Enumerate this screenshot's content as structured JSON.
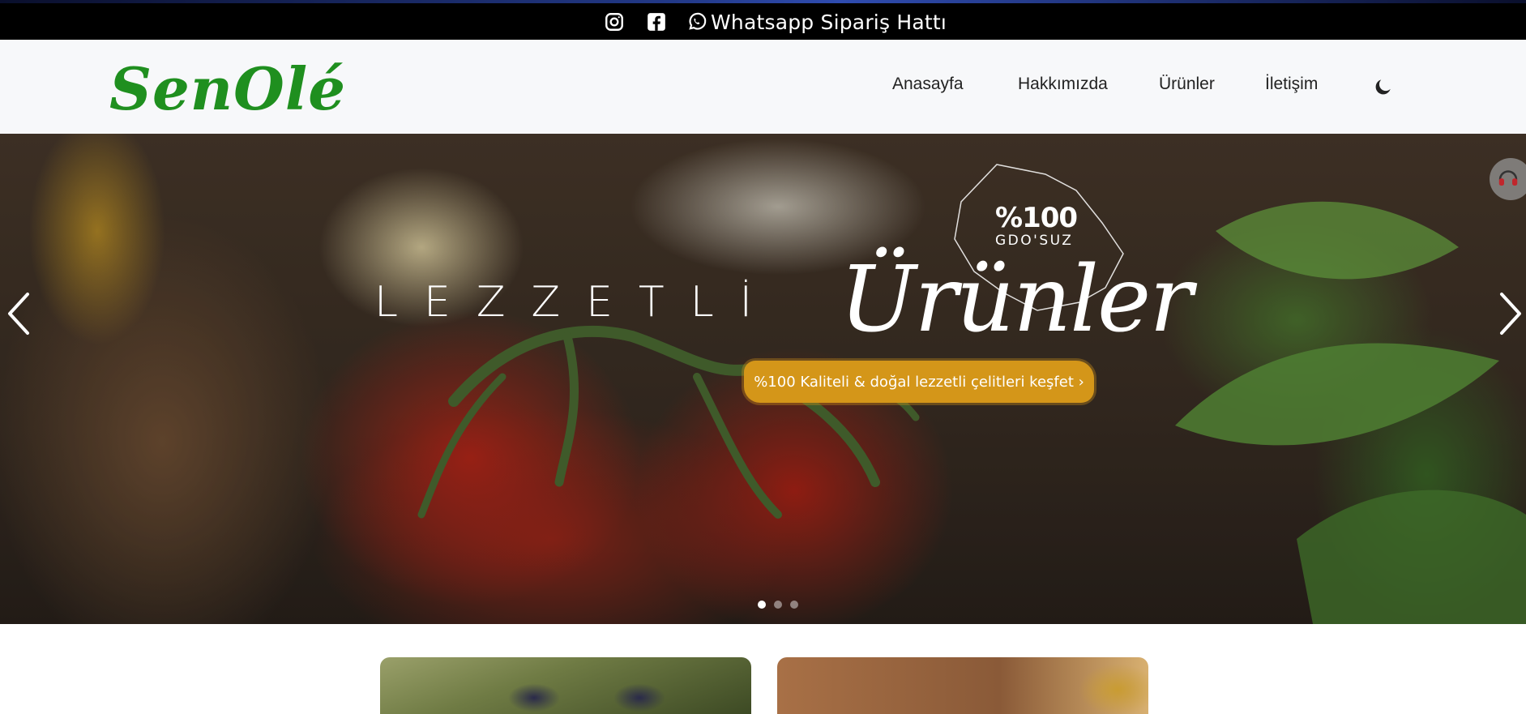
{
  "topbar": {
    "icons": [
      "instagram-icon",
      "facebook-icon",
      "whatsapp-icon"
    ],
    "whatsapp_label": "Whatsapp Sipariş Hattı"
  },
  "navbar": {
    "logo": "SenOlé",
    "items": [
      {
        "label": "Anasayfa"
      },
      {
        "label": "Hakkımızda"
      },
      {
        "label": "Ürünler"
      },
      {
        "label": "İletişim"
      }
    ],
    "theme_toggle_icon": "moon-icon"
  },
  "hero": {
    "badge_percent": "%100",
    "badge_sub": "GDO'SUZ",
    "headline_left": "LEZZETLİ",
    "headline_right": "Ürünler",
    "cta_label": "%100 Kaliteli & doğal lezzetli çelitleri keşfet ›",
    "prev_icon": "chevron-left-icon",
    "next_icon": "chevron-right-icon",
    "slide_count": 3,
    "active_slide": 1,
    "support_icon": "headphones-icon"
  },
  "colors": {
    "brand_green": "#1f8f1f",
    "cta_gold": "#d49619",
    "topbar_bg": "#000000",
    "navbar_bg": "#f7f8fa"
  }
}
